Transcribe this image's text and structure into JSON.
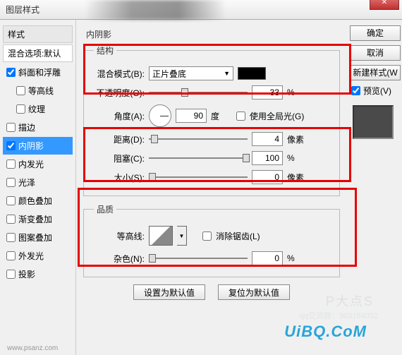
{
  "window": {
    "title": "图层样式"
  },
  "sidebar": {
    "header": "样式",
    "blend": "混合选项:默认",
    "items": [
      {
        "label": "斜面和浮雕",
        "checked": true
      },
      {
        "label": "等高线",
        "checked": false,
        "indent": true
      },
      {
        "label": "纹理",
        "checked": false,
        "indent": true
      },
      {
        "label": "描边",
        "checked": false
      },
      {
        "label": "内阴影",
        "checked": true,
        "selected": true
      },
      {
        "label": "内发光",
        "checked": false
      },
      {
        "label": "光泽",
        "checked": false
      },
      {
        "label": "颜色叠加",
        "checked": false
      },
      {
        "label": "渐变叠加",
        "checked": false
      },
      {
        "label": "图案叠加",
        "checked": false
      },
      {
        "label": "外发光",
        "checked": false
      },
      {
        "label": "投影",
        "checked": false
      }
    ]
  },
  "panel": {
    "title": "内阴影",
    "structure": {
      "legend": "结构",
      "blendmode_label": "混合模式(B):",
      "blendmode_value": "正片叠底",
      "opacity_label": "不透明度(O):",
      "opacity_value": "33",
      "opacity_unit": "%",
      "angle_label": "角度(A):",
      "angle_value": "90",
      "angle_unit": "度",
      "global_label": "使用全局光(G)",
      "distance_label": "距离(D):",
      "distance_value": "4",
      "distance_unit": "像素",
      "choke_label": "阻塞(C):",
      "choke_value": "100",
      "choke_unit": "%",
      "size_label": "大小(S):",
      "size_value": "0",
      "size_unit": "像素"
    },
    "quality": {
      "legend": "品质",
      "contour_label": "等高线:",
      "antialias_label": "消除锯齿(L)",
      "noise_label": "杂色(N):",
      "noise_value": "0",
      "noise_unit": "%"
    },
    "buttons": {
      "default": "设置为默认值",
      "reset": "复位为默认值"
    }
  },
  "right": {
    "ok": "确定",
    "cancel": "取消",
    "newstyle": "新建样式(W",
    "preview": "预览(V)"
  },
  "watermark": {
    "big": "P大点S",
    "sub": "qq交流群：303184032",
    "logo": "UiBQ.CoM",
    "url": "www.psanz.com"
  }
}
